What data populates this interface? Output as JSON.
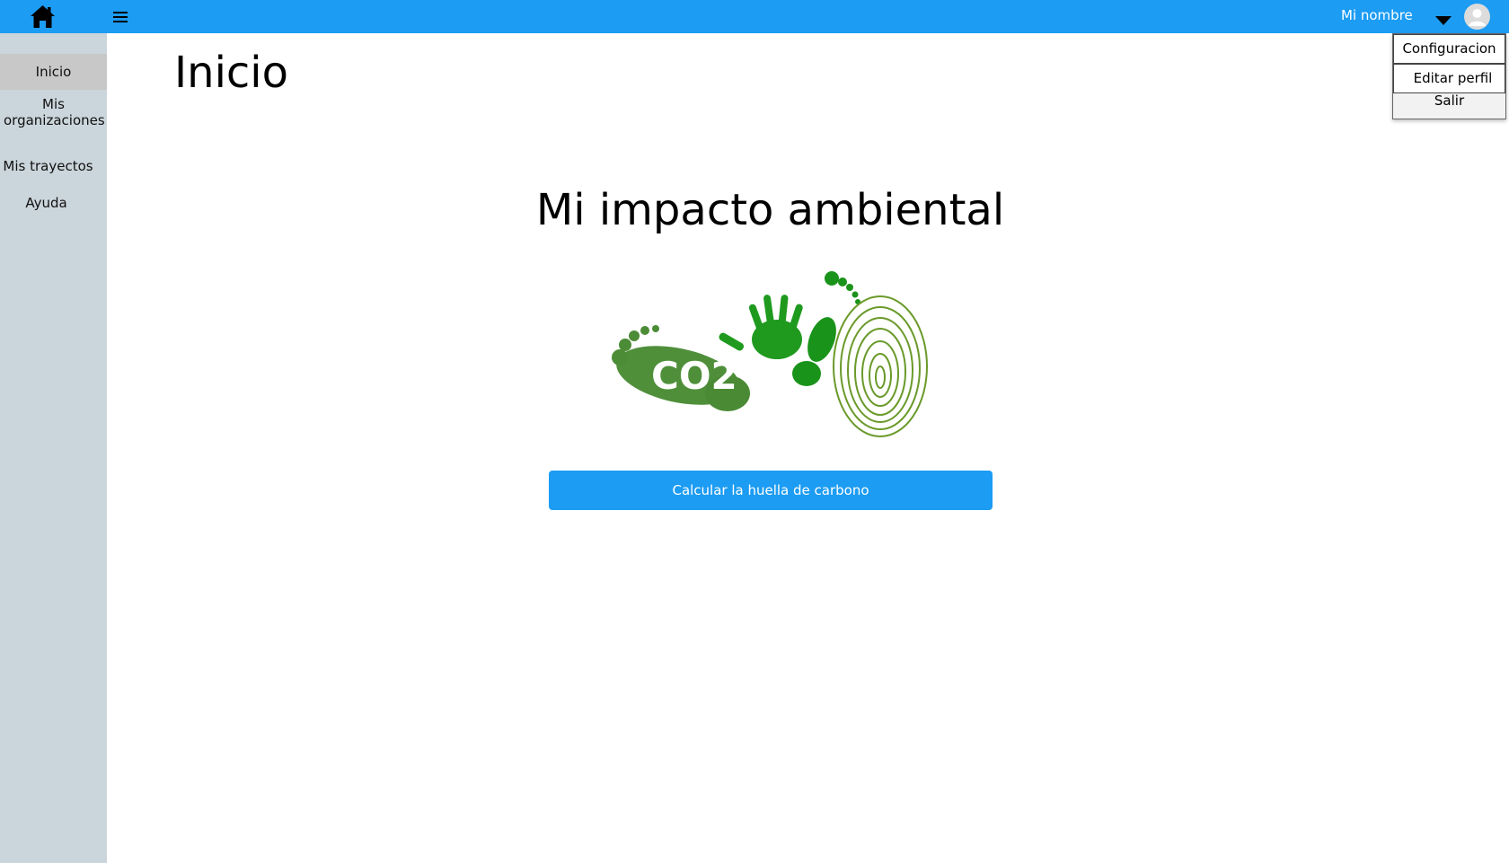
{
  "topbar": {
    "home_icon": "home-icon",
    "menu_icon": "hamburger-menu-icon",
    "user_name": "Mi nombre",
    "caret_icon": "caret-down-icon",
    "avatar_icon": "user-avatar-icon",
    "color": "#1c9cf3"
  },
  "sidebar": {
    "items": [
      {
        "label": "Inicio",
        "active": true
      },
      {
        "label": "Mis organizaciones",
        "active": false
      },
      {
        "label": "Mis trayectos",
        "active": false
      },
      {
        "label": "Ayuda",
        "active": false
      }
    ],
    "color": "#cbd5dc"
  },
  "main": {
    "title": "Inicio",
    "heading": "Mi impacto ambiental",
    "illustration": {
      "name": "carbon-footprint-illustration",
      "text": "CO2"
    },
    "button_label": "Calcular la huella de carbono"
  },
  "user_menu": {
    "items": [
      "Configuracion",
      "Editar perfil",
      "Salir"
    ]
  }
}
